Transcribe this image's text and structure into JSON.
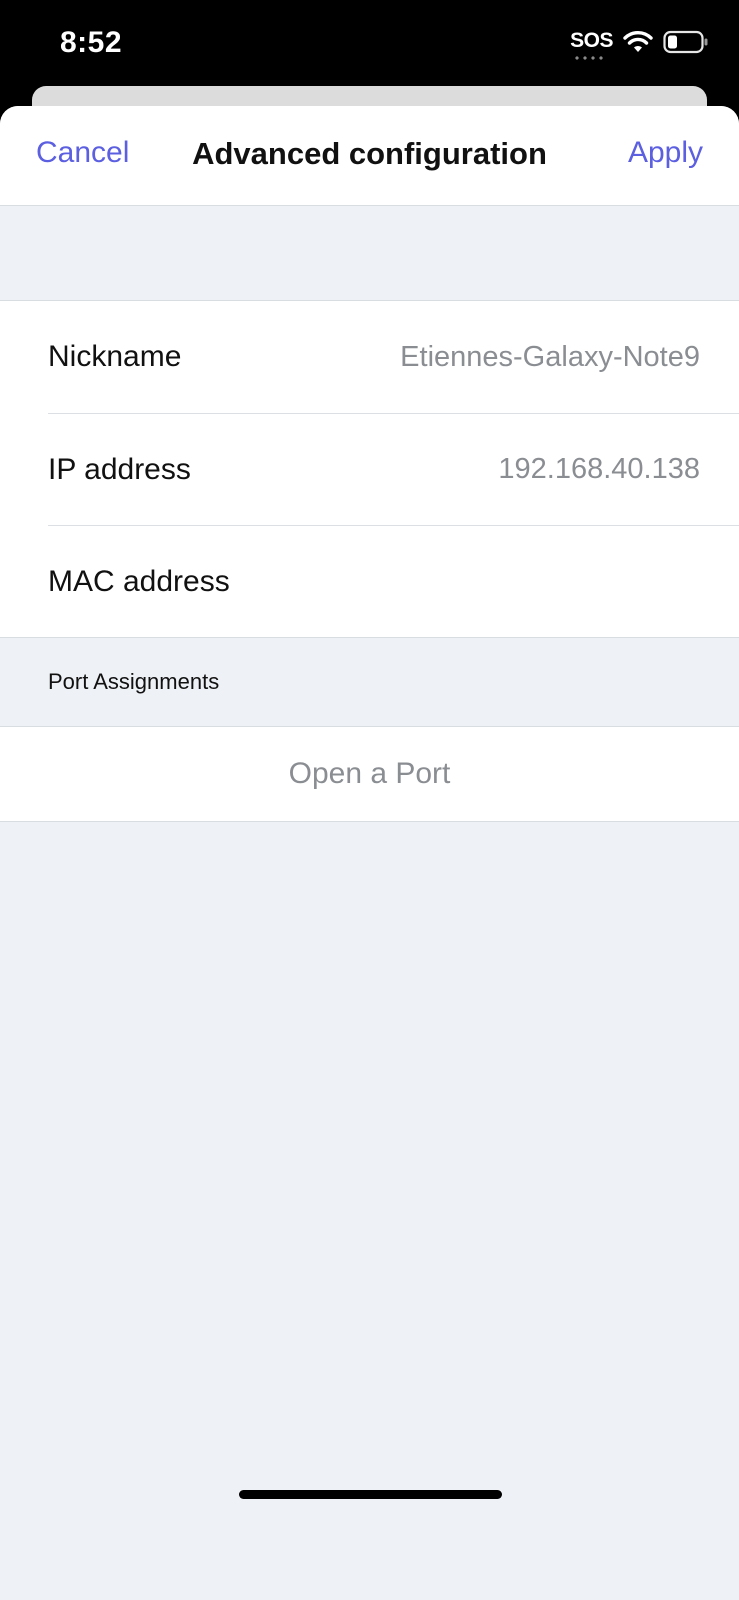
{
  "status_bar": {
    "time": "8:52",
    "sos": "SOS",
    "icons": [
      "wifi-icon",
      "battery-icon"
    ]
  },
  "nav": {
    "cancel_label": "Cancel",
    "title": "Advanced configuration",
    "apply_label": "Apply",
    "accent_color": "#5b5fe0"
  },
  "device": {
    "rows": [
      {
        "label": "Nickname",
        "value": "Etiennes-Galaxy-Note9"
      },
      {
        "label": "IP address",
        "value": "192.168.40.138"
      },
      {
        "label": "MAC address",
        "value": ""
      }
    ]
  },
  "ports": {
    "section_title": "Port Assignments",
    "open_port_label": "Open a Port"
  }
}
